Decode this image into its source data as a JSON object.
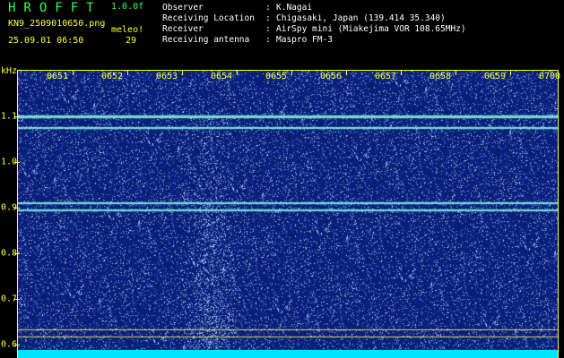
{
  "header": {
    "app_title": "HROFFT",
    "version": "1.0.0f",
    "filename": "KN9_2509010650.png",
    "meteor_label": "meleo!",
    "timestamp": "25.09.01 06:50",
    "meteor_count": "29"
  },
  "info": [
    {
      "label": "Observer",
      "sep": ":",
      "value": "K.Nagai"
    },
    {
      "label": "Receiving Location",
      "sep": ":",
      "value": "Chigasaki, Japan (139.414 35.340)"
    },
    {
      "label": "Receiver",
      "sep": ":",
      "value": "AirSpy mini (Miakejima VOR 108.65MHz)"
    },
    {
      "label": "Receiving antenna",
      "sep": ":",
      "value": "Maspro FM-3"
    }
  ],
  "spectrogram": {
    "freq_unit": "kHz",
    "time_labels": [
      "0651",
      "0652",
      "0653",
      "0654",
      "0655",
      "0656",
      "0657",
      "0658",
      "0659",
      "0700"
    ],
    "freq_labels": [
      "1.1",
      "1.0",
      "0.9",
      "0.8",
      "0.7",
      "0.6"
    ],
    "freq_range_khz": [
      0.57,
      1.2
    ],
    "carrier_lines_khz": [
      1.1,
      1.075,
      0.91,
      0.895
    ],
    "colors": {
      "background": "#0c1f7a",
      "axis": "#ffff33",
      "signal": "#00e5ff",
      "title": "#33ff55"
    }
  }
}
